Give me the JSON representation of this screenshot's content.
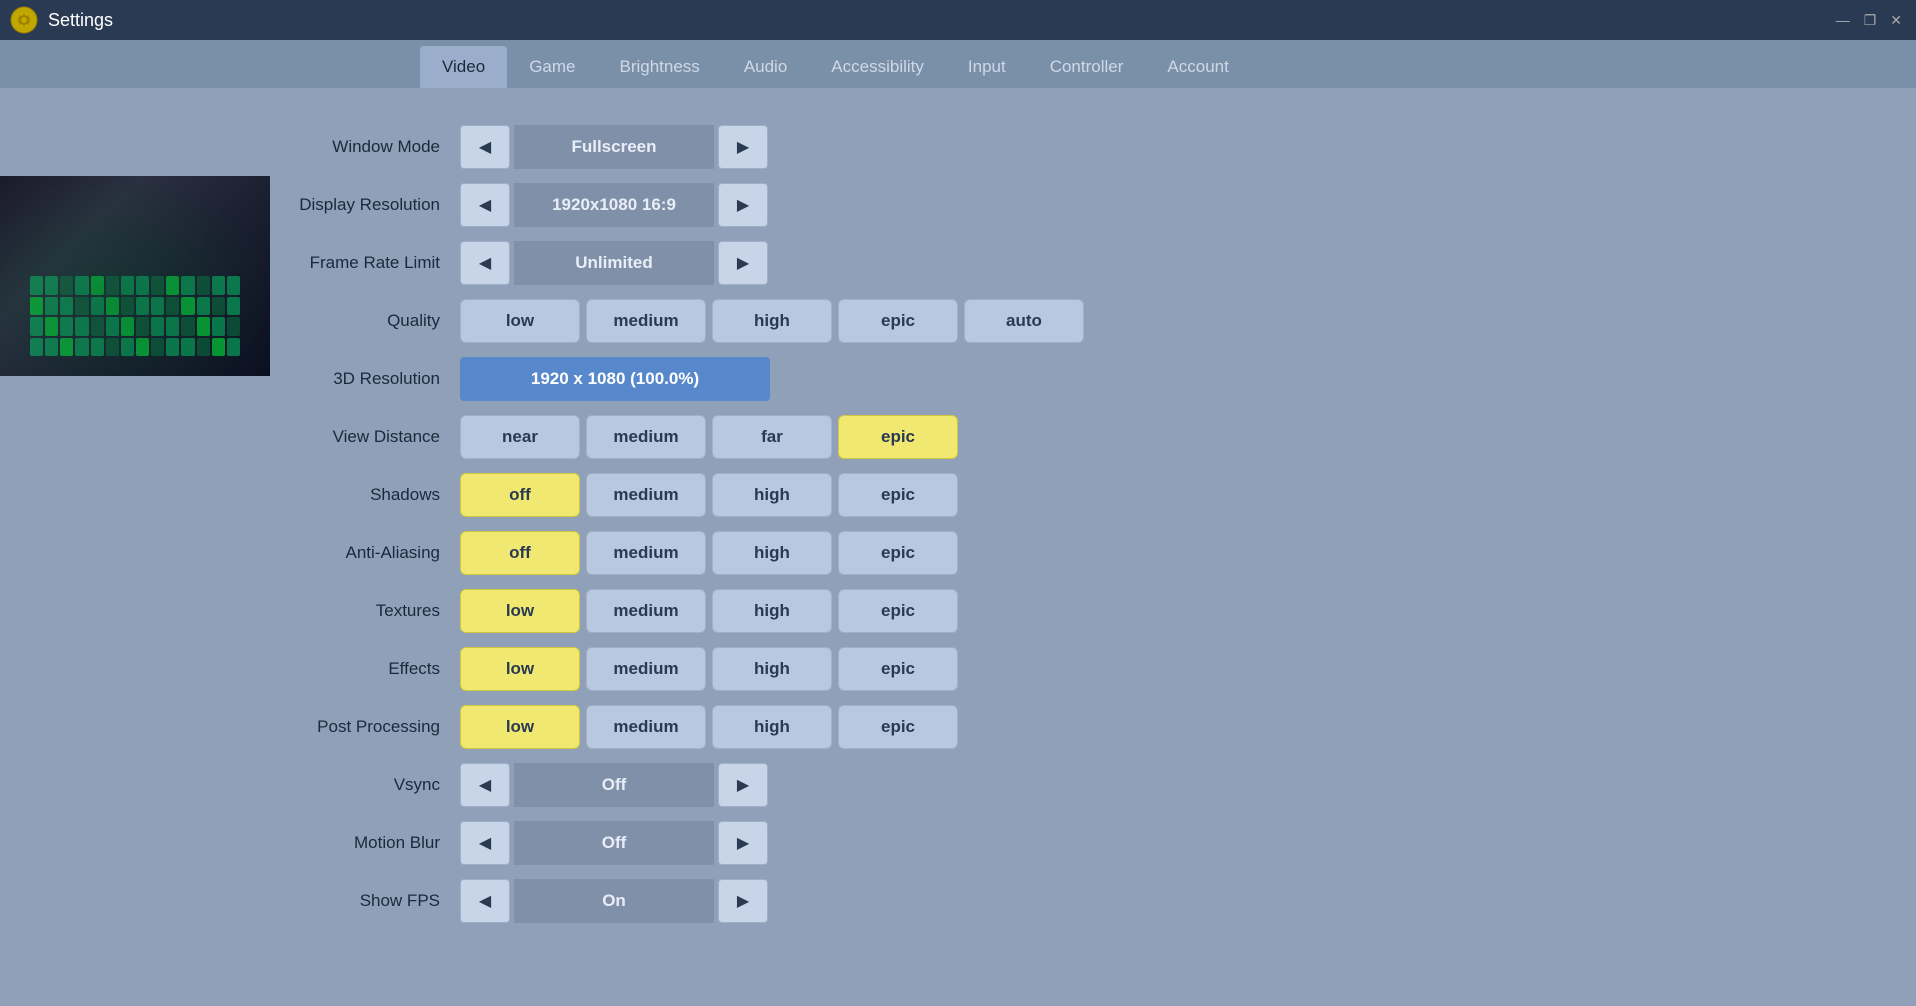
{
  "window": {
    "title": "Settings",
    "min_btn": "—",
    "max_btn": "❐",
    "close_btn": "✕"
  },
  "nav": {
    "tabs": [
      {
        "id": "video",
        "label": "Video",
        "active": true
      },
      {
        "id": "game",
        "label": "Game",
        "active": false
      },
      {
        "id": "brightness",
        "label": "Brightness",
        "active": false
      },
      {
        "id": "audio",
        "label": "Audio",
        "active": false
      },
      {
        "id": "accessibility",
        "label": "Accessibility",
        "active": false
      },
      {
        "id": "input",
        "label": "Input",
        "active": false
      },
      {
        "id": "controller",
        "label": "Controller",
        "active": false
      },
      {
        "id": "account",
        "label": "Account",
        "active": false
      }
    ]
  },
  "settings": {
    "window_mode": {
      "label": "Window Mode",
      "value": "Fullscreen"
    },
    "display_resolution": {
      "label": "Display Resolution",
      "value": "1920x1080 16:9"
    },
    "frame_rate_limit": {
      "label": "Frame Rate Limit",
      "value": "Unlimited"
    },
    "quality": {
      "label": "Quality",
      "options": [
        "low",
        "medium",
        "high",
        "epic",
        "auto"
      ],
      "selected": null
    },
    "resolution_3d": {
      "label": "3D Resolution",
      "value": "1920 x 1080 (100.0%)"
    },
    "view_distance": {
      "label": "View Distance",
      "options": [
        "near",
        "medium",
        "far",
        "epic"
      ],
      "selected": "epic"
    },
    "shadows": {
      "label": "Shadows",
      "options": [
        "off",
        "medium",
        "high",
        "epic"
      ],
      "selected": "off"
    },
    "anti_aliasing": {
      "label": "Anti-Aliasing",
      "options": [
        "off",
        "medium",
        "high",
        "epic"
      ],
      "selected": "off"
    },
    "textures": {
      "label": "Textures",
      "options": [
        "low",
        "medium",
        "high",
        "epic"
      ],
      "selected": "low"
    },
    "effects": {
      "label": "Effects",
      "options": [
        "low",
        "medium",
        "high",
        "epic"
      ],
      "selected": "low"
    },
    "post_processing": {
      "label": "Post Processing",
      "options": [
        "low",
        "medium",
        "high",
        "epic"
      ],
      "selected": "low"
    },
    "vsync": {
      "label": "Vsync",
      "value": "Off"
    },
    "motion_blur": {
      "label": "Motion Blur",
      "value": "Off"
    },
    "show_fps": {
      "label": "Show FPS",
      "value": "On"
    }
  }
}
